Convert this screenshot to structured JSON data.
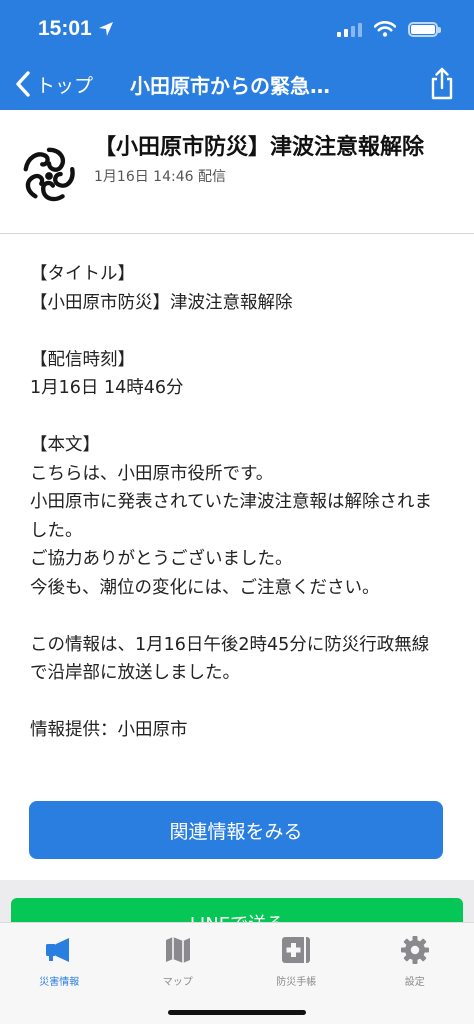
{
  "status_bar": {
    "time": "15:01"
  },
  "nav": {
    "back_label": "トップ",
    "title": "小田原市からの緊急…"
  },
  "header": {
    "title": "【小田原市防災】津波注意報解除",
    "date": "1月16日 14:46 配信"
  },
  "body": {
    "lines": [
      "【タイトル】",
      "【小田原市防災】津波注意報解除",
      "",
      "【配信時刻】",
      "1月16日 14時46分",
      "",
      "【本文】",
      "こちらは、小田原市役所です。",
      "小田原市に発表されていた津波注意報は解除されました。",
      "ご協力ありがとうございました。",
      "今後も、潮位の変化には、ご注意ください。",
      "",
      "この情報は、1月16日午後2時45分に防災行政無線で沿岸部に放送しました。",
      "",
      "情報提供：小田原市"
    ]
  },
  "related_button": "関連情報をみる",
  "line_button": "LINEで送る",
  "tabs": [
    {
      "label": "災害情報",
      "icon": "megaphone-icon",
      "active": true
    },
    {
      "label": "マップ",
      "icon": "map-icon",
      "active": false
    },
    {
      "label": "防災手帳",
      "icon": "first-aid-notebook-icon",
      "active": false
    },
    {
      "label": "設定",
      "icon": "gear-icon",
      "active": false
    }
  ],
  "colors": {
    "accent": "#2a7ee0",
    "line_green": "#06c755"
  }
}
